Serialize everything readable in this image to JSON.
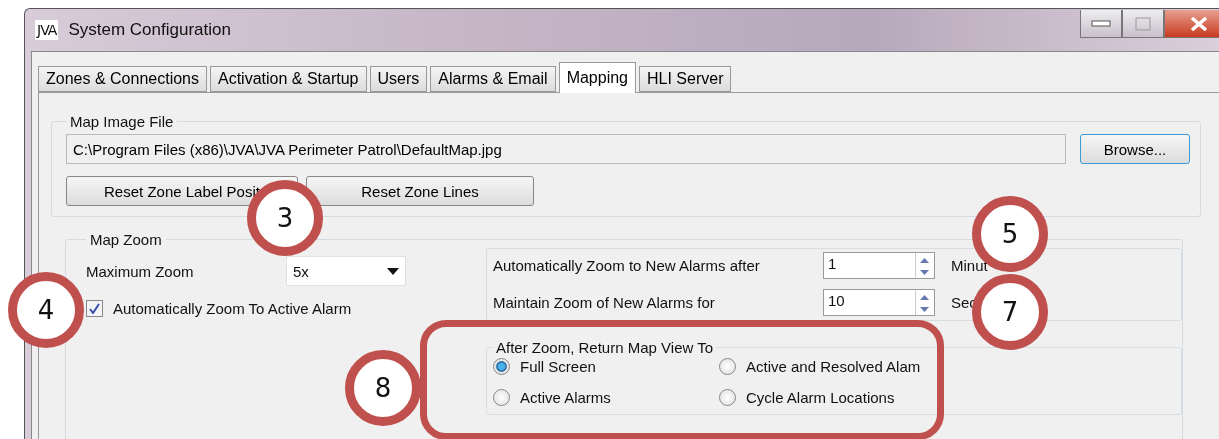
{
  "window": {
    "icon_text": "JVA",
    "title": "System Configuration"
  },
  "tabs": [
    {
      "label": "Zones & Connections",
      "selected": false
    },
    {
      "label": "Activation & Startup",
      "selected": false
    },
    {
      "label": "Users",
      "selected": false
    },
    {
      "label": "Alarms & Email",
      "selected": false
    },
    {
      "label": "Mapping",
      "selected": true
    },
    {
      "label": "HLI Server",
      "selected": false
    }
  ],
  "map_image_file": {
    "legend": "Map Image File",
    "path": "C:\\Program Files (x86)\\JVA\\JVA Perimeter Patrol\\DefaultMap.jpg",
    "browse_button": "Browse...",
    "buttons": [
      "Reset Zone Label Posit",
      "Reset Zone Lines"
    ]
  },
  "map_zoom": {
    "legend": "Map Zoom",
    "maximum_zoom_label": "Maximum Zoom",
    "maximum_zoom_value": "5x",
    "auto_zoom_checkbox": {
      "label": "Automatically Zoom To Active Alarm",
      "checked": true
    },
    "timing_rows": [
      {
        "label": "Automatically Zoom to New Alarms after",
        "value": "1",
        "unit": "Minut"
      },
      {
        "label": "Maintain Zoom of New Alarms for",
        "value": "10",
        "unit": "Sec"
      }
    ],
    "return_view": {
      "legend": "After Zoom, Return Map View To",
      "options": [
        {
          "label": "Full Screen",
          "selected": true
        },
        {
          "label": "Active and Resolved Alam",
          "selected": false
        },
        {
          "label": "Active Alarms",
          "selected": false
        },
        {
          "label": "Cycle Alarm Locations",
          "selected": false
        }
      ]
    }
  },
  "annotations": [
    {
      "label": "3"
    },
    {
      "label": "4"
    },
    {
      "label": "5"
    },
    {
      "label": "7"
    },
    {
      "label": "8"
    }
  ]
}
